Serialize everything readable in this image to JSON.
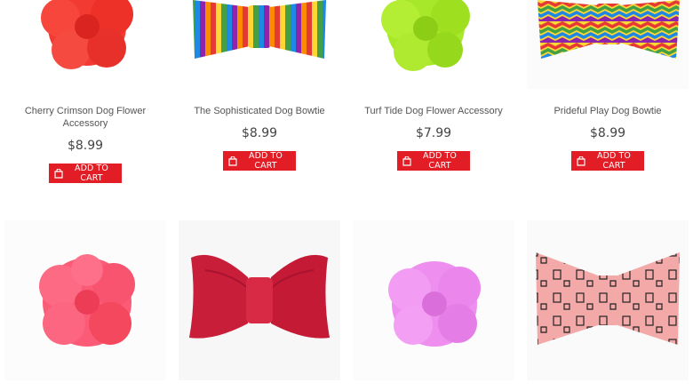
{
  "products": [
    {
      "title": "Cherry Crimson Dog Flower Accessory",
      "price": "$8.99",
      "cart_label": "ADD TO CART",
      "image": "red-flower"
    },
    {
      "title": "The Sophisticated Dog Bowtie",
      "price": "$8.99",
      "cart_label": "ADD TO CART",
      "image": "rainbow-stripe-bowtie"
    },
    {
      "title": "Turf Tide Dog Flower Accessory",
      "price": "$7.99",
      "cart_label": "ADD TO CART",
      "image": "lime-flower"
    },
    {
      "title": "Prideful Play Dog Bowtie",
      "price": "$8.99",
      "cart_label": "ADD TO CART",
      "image": "rainbow-chevron-bowtie"
    },
    {
      "image": "pink-flower"
    },
    {
      "image": "crimson-bowtie"
    },
    {
      "image": "lilac-flower"
    },
    {
      "image": "pink-printed-bowtie"
    }
  ],
  "colors": {
    "cart_button": "#e21d25"
  }
}
